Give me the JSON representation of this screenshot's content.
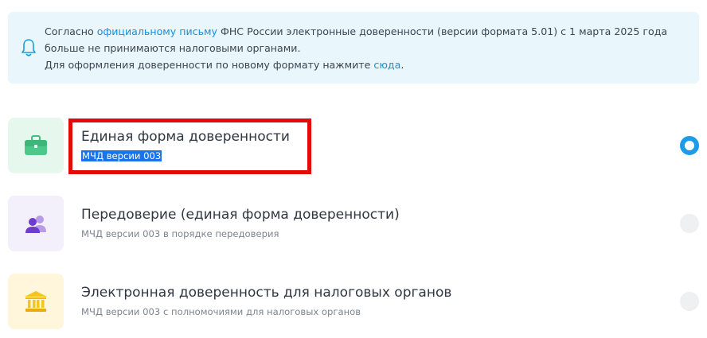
{
  "notice": {
    "line1_pre": "Согласно ",
    "line1_link": "официальному письму",
    "line1_post": " ФНС России электронные доверенности (версии формата 5.01) с 1 марта 2025 года больше не принимаются налоговыми органами.",
    "line2_pre": "Для оформления доверенности по новому формату нажмите ",
    "line2_link": "сюда",
    "line2_post": "."
  },
  "options": [
    {
      "title": "Единая форма доверенности",
      "subtitle": "МЧД версии 003",
      "icon": "briefcase-icon",
      "selected": true
    },
    {
      "title": "Передоверие (единая форма доверенности)",
      "subtitle": "МЧД версии 003 в порядке передоверия",
      "icon": "users-icon",
      "selected": false
    },
    {
      "title": "Электронная доверенность для налоговых органов",
      "subtitle": "МЧД версии 003 с полномочиями для налоговых органов",
      "icon": "bank-icon",
      "selected": false
    }
  ],
  "colors": {
    "accent": "#1e9be6",
    "highlight": "#e30a0a",
    "notice_bg": "#e9f6fc"
  }
}
